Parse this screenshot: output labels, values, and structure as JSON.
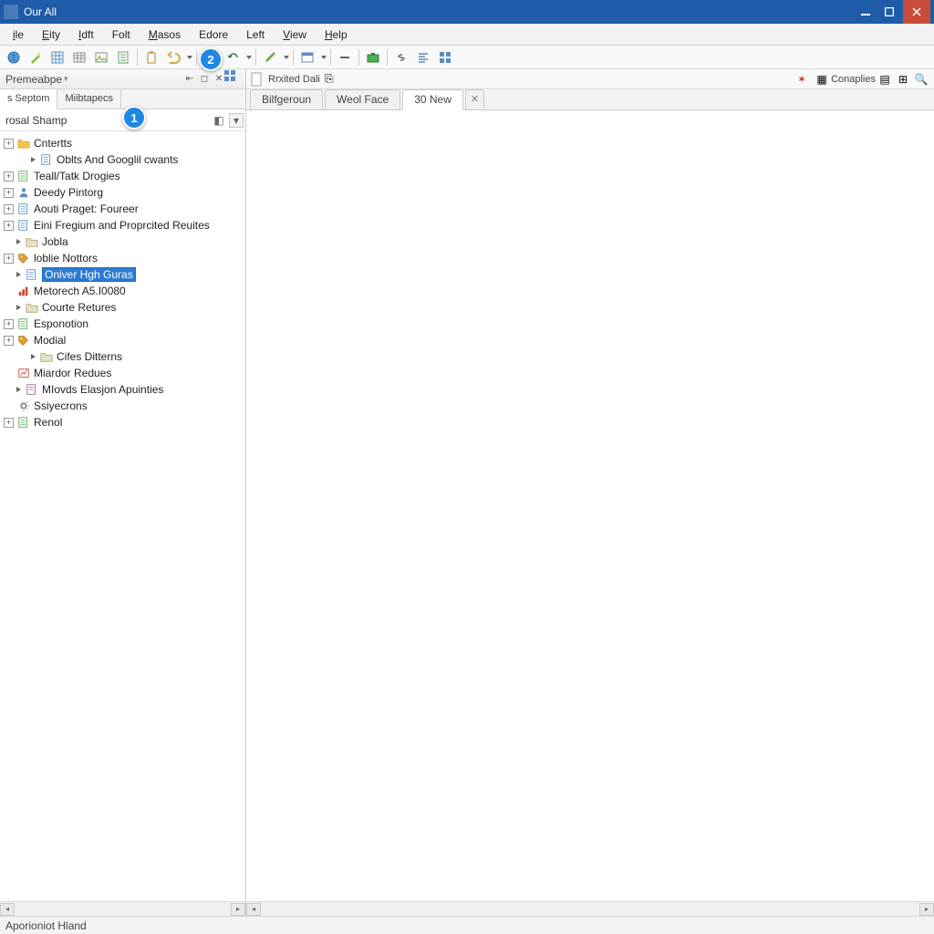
{
  "titlebar": {
    "title": "Our All"
  },
  "menubar": {
    "items": [
      {
        "label": "ile",
        "ul": "i"
      },
      {
        "label": "Eity",
        "ul": "E"
      },
      {
        "label": "Idft",
        "ul": "I"
      },
      {
        "label": "Folt",
        "ul": ""
      },
      {
        "label": "Masos",
        "ul": "M"
      },
      {
        "label": "Edore",
        "ul": ""
      },
      {
        "label": "Left",
        "ul": ""
      },
      {
        "label": "View",
        "ul": "V"
      },
      {
        "label": "Help",
        "ul": "H"
      }
    ]
  },
  "toolbar": {
    "icons": [
      "globe",
      "wand",
      "grid",
      "table",
      "picture",
      "sheet",
      "sep",
      "clipboard",
      "undo",
      "sep",
      "brush",
      "undo2",
      "sep",
      "pencil",
      "sep",
      "props",
      "sep",
      "minus",
      "sep",
      "case",
      "sep",
      "link",
      "align",
      "grid2"
    ]
  },
  "sidepanel": {
    "header": {
      "label": "Premeabpe",
      "buttons": [
        "left",
        "right",
        "close",
        "menu"
      ]
    },
    "tabs": [
      {
        "label": "s Septom",
        "active": true
      },
      {
        "label": "Miibtapecs",
        "active": false
      }
    ],
    "filter": {
      "value": "rosal Shamp"
    }
  },
  "tree": {
    "root_extra_icon": "grid-mini",
    "items": [
      {
        "level": 1,
        "toggle": "+",
        "arrow": false,
        "icon": "folder-y",
        "label": "Cntertts",
        "selected": false,
        "extra": true
      },
      {
        "level": 2,
        "toggle": "",
        "arrow": true,
        "icon": "page-b",
        "label": "Oblts And Googlil cwants",
        "selected": false
      },
      {
        "level": 1,
        "toggle": "+",
        "arrow": false,
        "icon": "page-g",
        "label": "Teall/Tatk Drogies",
        "selected": false
      },
      {
        "level": 1,
        "toggle": "+",
        "arrow": false,
        "icon": "human",
        "label": "Deedy Pintorg",
        "selected": false
      },
      {
        "level": 1,
        "toggle": "+",
        "arrow": false,
        "icon": "page-b",
        "label": "Aouti Praget: Foureer",
        "selected": false
      },
      {
        "level": 1,
        "toggle": "+",
        "arrow": false,
        "icon": "page-b",
        "label": "Eini Fregium and Proprcited Reuites",
        "selected": false
      },
      {
        "level": 1,
        "toggle": "",
        "arrow": true,
        "icon": "folder",
        "label": "Jobla",
        "selected": false
      },
      {
        "level": 1,
        "toggle": "+",
        "arrow": false,
        "icon": "tag",
        "label": "loblie Nottors",
        "selected": false
      },
      {
        "level": 1,
        "toggle": "",
        "arrow": true,
        "icon": "page-b",
        "label": "Oniver Hgh Guras",
        "selected": true
      },
      {
        "level": 1,
        "toggle": "",
        "arrow": false,
        "icon": "chart",
        "label": "Metorech A5.I0080",
        "selected": false
      },
      {
        "level": 1,
        "toggle": "",
        "arrow": true,
        "icon": "folder",
        "label": "Courte Retures",
        "selected": false
      },
      {
        "level": 1,
        "toggle": "+",
        "arrow": false,
        "icon": "page-g",
        "label": "Esponotion",
        "selected": false
      },
      {
        "level": 1,
        "toggle": "+",
        "arrow": false,
        "icon": "tag",
        "label": "Modial",
        "selected": false
      },
      {
        "level": 2,
        "toggle": "",
        "arrow": true,
        "icon": "folder",
        "label": "Cifes Ditterns",
        "selected": false
      },
      {
        "level": 1,
        "toggle": "",
        "arrow": false,
        "icon": "chart-r",
        "label": "Miardor Redues",
        "selected": false
      },
      {
        "level": 1,
        "toggle": "",
        "arrow": true,
        "icon": "page-p",
        "label": "MIovds Elasjon Apuinties",
        "selected": false
      },
      {
        "level": 1,
        "toggle": "",
        "arrow": false,
        "icon": "gear",
        "label": "Ssiyecrons",
        "selected": false
      },
      {
        "level": 1,
        "toggle": "+",
        "arrow": false,
        "icon": "page-g",
        "label": "Renol",
        "selected": false
      }
    ]
  },
  "main": {
    "topbar_left": {
      "label": "Rrxited Dali"
    },
    "topbar_right": {
      "label": "Conaplies"
    },
    "tabs": [
      {
        "label": "Bilfgeroun",
        "active": false
      },
      {
        "label": "Weol Face",
        "active": false
      },
      {
        "label": "30 New",
        "active": true
      }
    ]
  },
  "statusbar": {
    "text": "Aporioniot Hland"
  },
  "callouts": {
    "one": "1",
    "two": "2"
  }
}
